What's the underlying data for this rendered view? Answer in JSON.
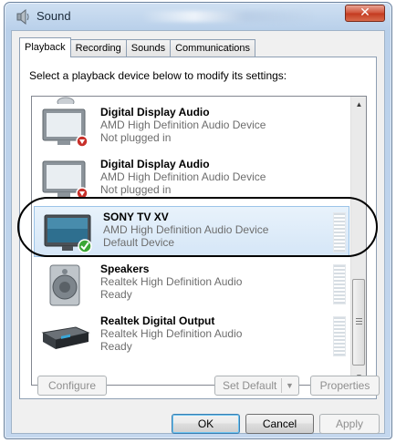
{
  "window": {
    "title": "Sound",
    "close_glyph": "✕"
  },
  "tabs": [
    {
      "label": "Playback",
      "active": true
    },
    {
      "label": "Recording",
      "active": false
    },
    {
      "label": "Sounds",
      "active": false
    },
    {
      "label": "Communications",
      "active": false
    }
  ],
  "instruction": "Select a playback device below to modify its settings:",
  "devices": [
    {
      "name": "Digital Display Audio",
      "description": "AMD High Definition Audio Device",
      "status": "Not plugged in",
      "icon": "monitor-icon",
      "badge": "unplugged-badge"
    },
    {
      "name": "Digital Display Audio",
      "description": "AMD High Definition Audio Device",
      "status": "Not plugged in",
      "icon": "monitor-icon",
      "badge": "unplugged-badge"
    },
    {
      "name": "SONY TV XV",
      "description": "AMD High Definition Audio Device",
      "status": "Default Device",
      "icon": "tv-icon",
      "badge": "default-check-badge"
    },
    {
      "name": "Speakers",
      "description": "Realtek High Definition Audio",
      "status": "Ready",
      "icon": "speaker-icon"
    },
    {
      "name": "Realtek Digital Output",
      "description": "Realtek High Definition Audio",
      "status": "Ready",
      "icon": "digital-output-icon"
    }
  ],
  "buttons": {
    "configure": "Configure",
    "set_default": "Set Default",
    "properties": "Properties",
    "ok": "OK",
    "cancel": "Cancel",
    "apply": "Apply"
  },
  "colors": {
    "selection": "#d5e6f7",
    "default_check": "#3aa635",
    "unplugged": "#c8302a"
  }
}
